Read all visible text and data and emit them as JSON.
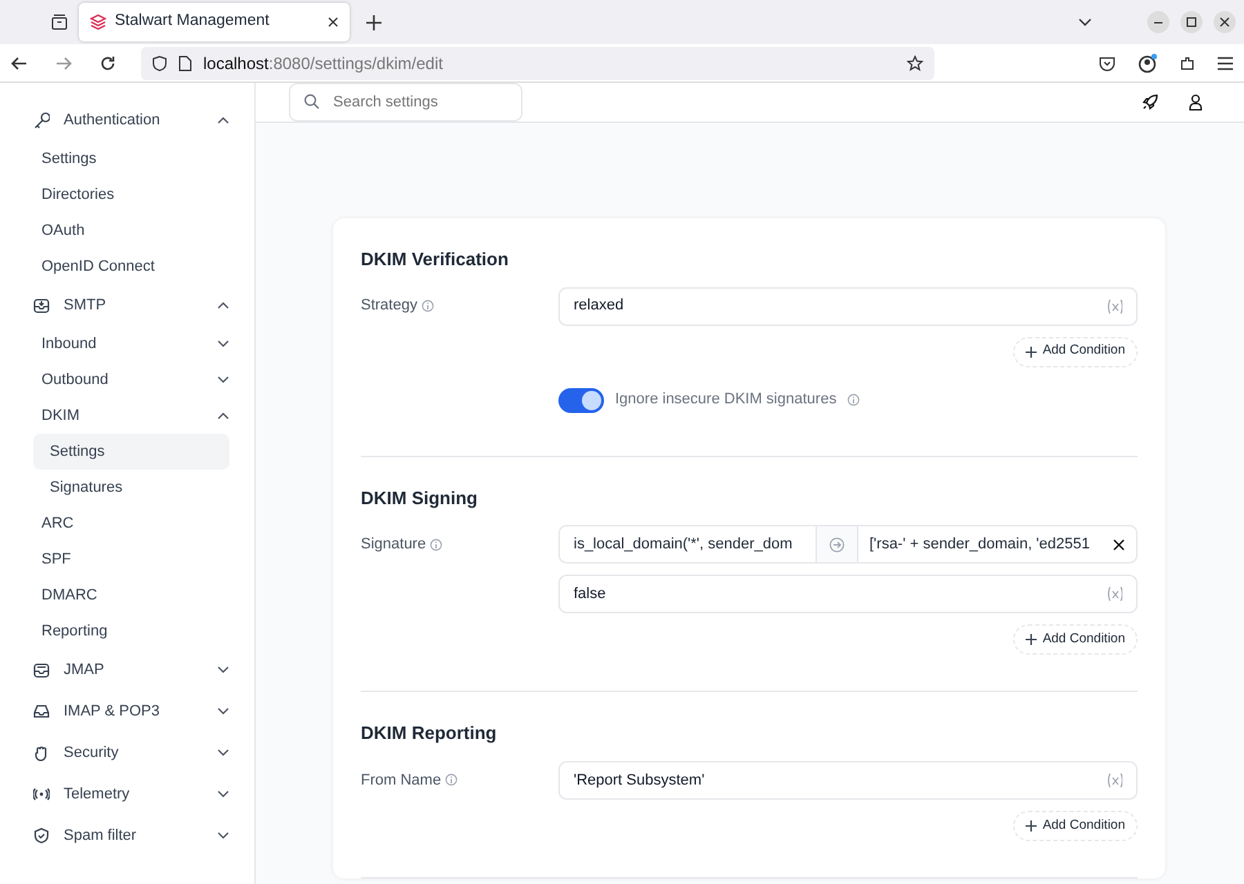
{
  "browser": {
    "tab_title": "Stalwart Management",
    "url_host": "localhost",
    "url_path": ":8080/settings/dkim/edit"
  },
  "sidebar": [
    {
      "label": "Authentication",
      "expanded": true,
      "children": [
        {
          "label": "Settings",
          "kind": "link",
          "selected": false
        },
        {
          "label": "Directories",
          "kind": "link",
          "selected": false
        },
        {
          "label": "OAuth",
          "kind": "link",
          "selected": false
        },
        {
          "label": "OpenID Connect",
          "kind": "link",
          "selected": false
        }
      ]
    },
    {
      "label": "SMTP",
      "expanded": true,
      "children": [
        {
          "label": "Inbound",
          "kind": "group",
          "expanded": false,
          "selected": false
        },
        {
          "label": "Outbound",
          "kind": "group",
          "expanded": false,
          "selected": false
        },
        {
          "label": "DKIM",
          "kind": "group",
          "expanded": true,
          "selected": false,
          "children": [
            {
              "label": "Settings",
              "kind": "link",
              "selected": true
            },
            {
              "label": "Signatures",
              "kind": "link",
              "selected": false
            }
          ]
        },
        {
          "label": "ARC",
          "kind": "link",
          "selected": false
        },
        {
          "label": "SPF",
          "kind": "link",
          "selected": false
        },
        {
          "label": "DMARC",
          "kind": "link",
          "selected": false
        },
        {
          "label": "Reporting",
          "kind": "link",
          "selected": false
        }
      ]
    },
    {
      "label": "JMAP",
      "expanded": false
    },
    {
      "label": "IMAP & POP3",
      "expanded": false
    },
    {
      "label": "Security",
      "expanded": false
    },
    {
      "label": "Telemetry",
      "expanded": false
    },
    {
      "label": "Spam filter",
      "expanded": false
    }
  ],
  "search": {
    "placeholder": "Search settings"
  },
  "sections": [
    {
      "title": "DKIM Verification",
      "fields": [
        {
          "kind": "expression",
          "label": "Strategy",
          "value": "relaxed",
          "add_condition": "Add Condition"
        },
        {
          "kind": "toggle",
          "label": "Ignore insecure DKIM signatures",
          "on": true
        }
      ]
    },
    {
      "title": "DKIM Signing",
      "fields": [
        {
          "kind": "expression",
          "label": "Signature",
          "conditions": [
            {
              "if": "is_local_domain('*', sender_dom",
              "then": "['rsa-' + sender_domain, 'ed2551"
            }
          ],
          "value": "false",
          "add_condition": "Add Condition"
        }
      ]
    },
    {
      "title": "DKIM Reporting",
      "fields": [
        {
          "kind": "expression",
          "label": "From Name",
          "value": "'Report Subsystem'",
          "add_condition": "Add Condition"
        }
      ]
    }
  ]
}
